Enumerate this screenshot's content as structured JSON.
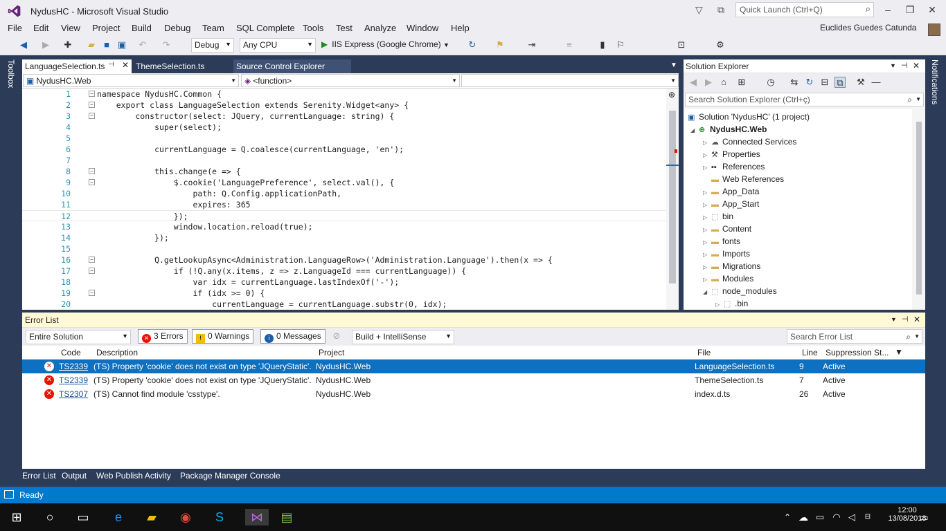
{
  "window": {
    "title": "NydusHC - Microsoft Visual Studio",
    "quick_launch_placeholder": "Quick Launch (Ctrl+Q)",
    "user": "Euclides Guedes Catunda"
  },
  "menu": [
    "File",
    "Edit",
    "View",
    "Project",
    "Build",
    "Debug",
    "Team",
    "SQL Complete",
    "Tools",
    "Test",
    "Analyze",
    "Window",
    "Help"
  ],
  "toolbar": {
    "config": "Debug",
    "platform": "Any CPU",
    "run_target": "IIS Express (Google Chrome)"
  },
  "side": {
    "toolbox": "Toolbox",
    "notifications": "Notifications"
  },
  "editor": {
    "tabs": [
      {
        "label": "LanguageSelection.ts",
        "active": true
      },
      {
        "label": "ThemeSelection.ts",
        "active": false
      },
      {
        "label": "Source Control Explorer",
        "active": false
      }
    ],
    "nav_project": "NydusHC.Web",
    "nav_member": "<function>",
    "lines": [
      {
        "n": "1",
        "t": "namespace NydusHC.Common {"
      },
      {
        "n": "2",
        "t": "    export class LanguageSelection extends Serenity.Widget<any> {"
      },
      {
        "n": "3",
        "t": "        constructor(select: JQuery, currentLanguage: string) {"
      },
      {
        "n": "4",
        "t": "            super(select);"
      },
      {
        "n": "5",
        "t": ""
      },
      {
        "n": "6",
        "t": "            currentLanguage = Q.coalesce(currentLanguage, 'en');"
      },
      {
        "n": "7",
        "t": ""
      },
      {
        "n": "8",
        "t": "            this.change(e => {"
      },
      {
        "n": "9",
        "t": "                $.cookie('LanguagePreference', select.val(), {"
      },
      {
        "n": "10",
        "t": "                    path: Q.Config.applicationPath,"
      },
      {
        "n": "11",
        "t": "                    expires: 365"
      },
      {
        "n": "12",
        "t": "                });"
      },
      {
        "n": "13",
        "t": "                window.location.reload(true);"
      },
      {
        "n": "14",
        "t": "            });"
      },
      {
        "n": "15",
        "t": ""
      },
      {
        "n": "16",
        "t": "            Q.getLookupAsync<Administration.LanguageRow>('Administration.Language').then(x => {"
      },
      {
        "n": "17",
        "t": "                if (!Q.any(x.items, z => z.LanguageId === currentLanguage)) {"
      },
      {
        "n": "18",
        "t": "                    var idx = currentLanguage.lastIndexOf('-');"
      },
      {
        "n": "19",
        "t": "                    if (idx >= 0) {"
      },
      {
        "n": "20",
        "t": "                        currentLanguage = currentLanguage.substr(0, idx);"
      }
    ]
  },
  "solution_explorer": {
    "title": "Solution Explorer",
    "search_placeholder": "Search Solution Explorer (Ctrl+ç)",
    "items": [
      {
        "label": "Solution 'NydusHC' (1 project)",
        "depth": 0,
        "expander": "",
        "icon": "solution-icon"
      },
      {
        "label": "NydusHC.Web",
        "depth": 1,
        "expander": "◢",
        "icon": "web-project-icon",
        "bold": true
      },
      {
        "label": "Connected Services",
        "depth": 2,
        "expander": "▷",
        "icon": "cloud-icon"
      },
      {
        "label": "Properties",
        "depth": 2,
        "expander": "▷",
        "icon": "wrench-icon"
      },
      {
        "label": "References",
        "depth": 2,
        "expander": "▷",
        "icon": "references-icon"
      },
      {
        "label": "Web References",
        "depth": 2,
        "expander": "",
        "icon": "folder-icon"
      },
      {
        "label": "App_Data",
        "depth": 2,
        "expander": "▷",
        "icon": "folder-icon"
      },
      {
        "label": "App_Start",
        "depth": 2,
        "expander": "▷",
        "icon": "folder-icon"
      },
      {
        "label": "bin",
        "depth": 2,
        "expander": "▷",
        "icon": "dashed-folder-icon"
      },
      {
        "label": "Content",
        "depth": 2,
        "expander": "▷",
        "icon": "folder-icon"
      },
      {
        "label": "fonts",
        "depth": 2,
        "expander": "▷",
        "icon": "folder-icon"
      },
      {
        "label": "Imports",
        "depth": 2,
        "expander": "▷",
        "icon": "folder-icon"
      },
      {
        "label": "Migrations",
        "depth": 2,
        "expander": "▷",
        "icon": "folder-icon"
      },
      {
        "label": "Modules",
        "depth": 2,
        "expander": "▷",
        "icon": "folder-icon"
      },
      {
        "label": "node_modules",
        "depth": 2,
        "expander": "◢",
        "icon": "dashed-folder-icon"
      },
      {
        "label": ".bin",
        "depth": 3,
        "expander": "▷",
        "icon": "dashed-folder-icon"
      }
    ]
  },
  "error_list": {
    "title": "Error List",
    "scope": "Entire Solution",
    "errors_label": "3 Errors",
    "warnings_label": "0 Warnings",
    "messages_label": "0 Messages",
    "source": "Build + IntelliSense",
    "search_placeholder": "Search Error List",
    "columns": [
      "Code",
      "Description",
      "Project",
      "File",
      "Line",
      "Suppression St..."
    ],
    "rows": [
      {
        "code": "TS2339",
        "desc": "(TS) Property 'cookie' does not exist on type 'JQueryStatic'.",
        "project": "NydusHC.Web",
        "file": "LanguageSelection.ts",
        "line": "9",
        "state": "Active",
        "selected": true
      },
      {
        "code": "TS2339",
        "desc": "(TS) Property 'cookie' does not exist on type 'JQueryStatic'.",
        "project": "NydusHC.Web",
        "file": "ThemeSelection.ts",
        "line": "7",
        "state": "Active",
        "selected": false
      },
      {
        "code": "TS2307",
        "desc": "(TS) Cannot find module 'csstype'.",
        "project": "NydusHC.Web",
        "file": "index.d.ts",
        "line": "26",
        "state": "Active",
        "selected": false
      }
    ]
  },
  "bottom_tabs": [
    "Error List",
    "Output",
    "Web Publish Activity",
    "Package Manager Console"
  ],
  "status": "Ready",
  "clock": {
    "time": "12:00",
    "date": "13/08/2018"
  },
  "colors": {
    "accent": "#007acc",
    "error": "#e51400",
    "selected_row": "#0e70c0"
  }
}
